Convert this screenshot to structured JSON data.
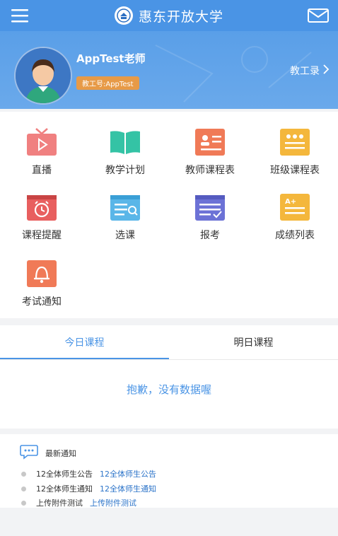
{
  "header": {
    "title": "惠东开放大学",
    "logo_icon": "university-logo-icon",
    "menu_icon": "menu-icon",
    "mail_icon": "mail-icon",
    "bar_color": "#4a94e5"
  },
  "profile": {
    "name": "AppTest老师",
    "badge": "教工号:AppTest",
    "record_link": "教工录",
    "record_icon": "chevron-right-icon"
  },
  "grid": {
    "items": [
      {
        "label": "直播",
        "icon": "tv-live-icon",
        "color": "#f08080"
      },
      {
        "label": "教学计划",
        "icon": "open-book-icon",
        "color": "#34c3a5"
      },
      {
        "label": "教师课程表",
        "icon": "teacher-schedule-icon",
        "color": "#f07a57"
      },
      {
        "label": "班级课程表",
        "icon": "class-schedule-icon",
        "color": "#f4b73c"
      },
      {
        "label": "课程提醒",
        "icon": "alarm-clock-icon",
        "color": "#e85f5f"
      },
      {
        "label": "选课",
        "icon": "calendar-search-icon",
        "color": "#5ab6e8"
      },
      {
        "label": "报考",
        "icon": "exam-register-icon",
        "color": "#6c72d6"
      },
      {
        "label": "成绩列表",
        "icon": "grade-list-icon",
        "color": "#f4b73c"
      },
      {
        "label": "考试通知",
        "icon": "bell-icon",
        "color": "#f07a57"
      }
    ]
  },
  "tabs": {
    "items": [
      {
        "label": "今日课程"
      },
      {
        "label": "明日课程"
      }
    ],
    "active_index": 0,
    "empty_message": "抱歉，没有数据喔"
  },
  "notices": {
    "title": "最新通知",
    "icon": "chat-bubble-icon",
    "items": [
      {
        "type": "12全体师生公告",
        "title": "12全体师生公告"
      },
      {
        "type": "12全体师生通知",
        "title": "12全体师生通知"
      },
      {
        "type": "上传附件测试",
        "title": "上传附件测试"
      }
    ]
  }
}
